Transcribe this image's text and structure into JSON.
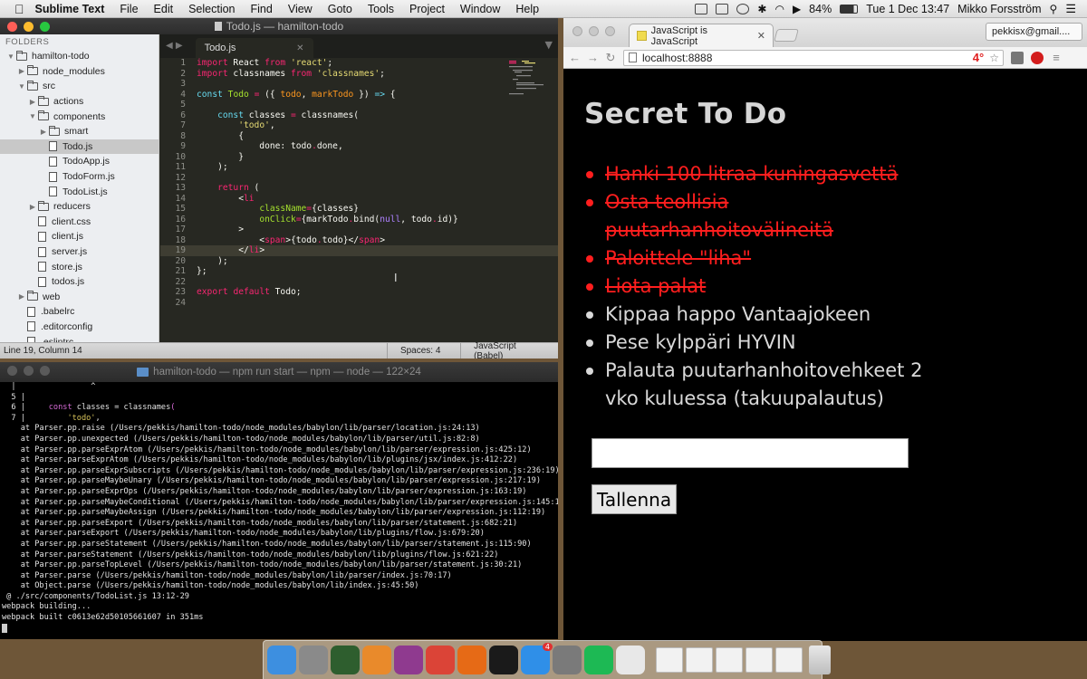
{
  "menubar": {
    "app_name": "Sublime Text",
    "items": [
      "File",
      "Edit",
      "Selection",
      "Find",
      "View",
      "Goto",
      "Tools",
      "Project",
      "Window",
      "Help"
    ],
    "battery": "84%",
    "clock": "Tue 1 Dec  13:47",
    "user": "Mikko Forsström"
  },
  "sublime": {
    "window_title": "Todo.js — hamilton-todo",
    "sidebar_header": "FOLDERS",
    "tree": [
      {
        "label": "hamilton-todo",
        "type": "folder",
        "open": true,
        "depth": 0
      },
      {
        "label": "node_modules",
        "type": "folder",
        "open": false,
        "depth": 1
      },
      {
        "label": "src",
        "type": "folder",
        "open": true,
        "depth": 1
      },
      {
        "label": "actions",
        "type": "folder",
        "open": false,
        "depth": 2
      },
      {
        "label": "components",
        "type": "folder",
        "open": true,
        "depth": 2
      },
      {
        "label": "smart",
        "type": "folder",
        "open": false,
        "depth": 3
      },
      {
        "label": "Todo.js",
        "type": "file",
        "depth": 3,
        "selected": true
      },
      {
        "label": "TodoApp.js",
        "type": "file",
        "depth": 3
      },
      {
        "label": "TodoForm.js",
        "type": "file",
        "depth": 3
      },
      {
        "label": "TodoList.js",
        "type": "file",
        "depth": 3
      },
      {
        "label": "reducers",
        "type": "folder",
        "open": false,
        "depth": 2
      },
      {
        "label": "client.css",
        "type": "file",
        "depth": 2
      },
      {
        "label": "client.js",
        "type": "file",
        "depth": 2
      },
      {
        "label": "server.js",
        "type": "file",
        "depth": 2
      },
      {
        "label": "store.js",
        "type": "file",
        "depth": 2
      },
      {
        "label": "todos.js",
        "type": "file",
        "depth": 2
      },
      {
        "label": "web",
        "type": "folder",
        "open": false,
        "depth": 1
      },
      {
        "label": ".babelrc",
        "type": "file",
        "depth": 1
      },
      {
        "label": ".editorconfig",
        "type": "file",
        "depth": 1
      },
      {
        "label": ".eslintrc",
        "type": "file",
        "depth": 1
      }
    ],
    "tab_label": "Todo.js",
    "current_line": 19,
    "code": [
      [
        [
          "kw",
          "import"
        ],
        [
          "pl",
          " React "
        ],
        [
          "kw",
          "from"
        ],
        [
          "pl",
          " "
        ],
        [
          "st",
          "'react'"
        ],
        [
          "pl",
          ";"
        ]
      ],
      [
        [
          "kw",
          "import"
        ],
        [
          "pl",
          " classnames "
        ],
        [
          "kw",
          "from"
        ],
        [
          "pl",
          " "
        ],
        [
          "st",
          "'classnames'"
        ],
        [
          "pl",
          ";"
        ]
      ],
      [],
      [
        [
          "bl",
          "const"
        ],
        [
          "pl",
          " "
        ],
        [
          "fn",
          "Todo"
        ],
        [
          "pl",
          " "
        ],
        [
          "kw",
          "="
        ],
        [
          "pl",
          " ({ "
        ],
        [
          "pr",
          "todo"
        ],
        [
          "pl",
          ", "
        ],
        [
          "pr",
          "markTodo"
        ],
        [
          "pl",
          " }) "
        ],
        [
          "bl",
          "=>"
        ],
        [
          "pl",
          " {"
        ]
      ],
      [],
      [
        [
          "pl",
          "    "
        ],
        [
          "bl",
          "const"
        ],
        [
          "pl",
          " classes "
        ],
        [
          "kw",
          "="
        ],
        [
          "pl",
          " classnames("
        ]
      ],
      [
        [
          "pl",
          "        "
        ],
        [
          "st",
          "'todo'"
        ],
        [
          "pl",
          ","
        ]
      ],
      [
        [
          "pl",
          "        {"
        ]
      ],
      [
        [
          "pl",
          "            done: todo"
        ],
        [
          "kw",
          "."
        ],
        [
          "pl",
          "done,"
        ]
      ],
      [
        [
          "pl",
          "        }"
        ]
      ],
      [
        [
          "pl",
          "    );"
        ]
      ],
      [],
      [
        [
          "pl",
          "    "
        ],
        [
          "kw",
          "return"
        ],
        [
          "pl",
          " ("
        ]
      ],
      [
        [
          "pl",
          "        <"
        ],
        [
          "kw",
          "li"
        ]
      ],
      [
        [
          "pl",
          "            "
        ],
        [
          "fn",
          "className"
        ],
        [
          "kw",
          "="
        ],
        [
          "pl",
          "{classes}"
        ]
      ],
      [
        [
          "pl",
          "            "
        ],
        [
          "fn",
          "onClick"
        ],
        [
          "kw",
          "="
        ],
        [
          "pl",
          "{markTodo"
        ],
        [
          "kw",
          "."
        ],
        [
          "pl",
          "bind("
        ],
        [
          "nm",
          "null"
        ],
        [
          "pl",
          ", todo"
        ],
        [
          "kw",
          "."
        ],
        [
          "pl",
          "id)}"
        ]
      ],
      [
        [
          "pl",
          "        >"
        ]
      ],
      [
        [
          "pl",
          "            <"
        ],
        [
          "kw",
          "span"
        ],
        [
          "pl",
          ">{todo"
        ],
        [
          "kw",
          "."
        ],
        [
          "pl",
          "todo}</"
        ],
        [
          "kw",
          "span"
        ],
        [
          "pl",
          ">"
        ]
      ],
      [
        [
          "pl",
          "        </"
        ],
        [
          "kw",
          "li"
        ],
        [
          "pl",
          ">"
        ]
      ],
      [
        [
          "pl",
          "    );"
        ]
      ],
      [
        [
          "pl",
          "};"
        ]
      ],
      [],
      [
        [
          "kw",
          "export"
        ],
        [
          "pl",
          " "
        ],
        [
          "kw",
          "default"
        ],
        [
          "pl",
          " Todo;"
        ]
      ],
      []
    ],
    "status": {
      "position": "Line 19, Column 14",
      "spaces": "Spaces: 4",
      "syntax": "JavaScript (Babel)"
    }
  },
  "terminal": {
    "title": "hamilton-todo — npm run start — npm — node — 122×24",
    "lines": [
      "  |                ^",
      "  5 |",
      "  6 |     const classes = classnames(",
      "  7 |         'todo',",
      "    at Parser.pp.raise (/Users/pekkis/hamilton-todo/node_modules/babylon/lib/parser/location.js:24:13)",
      "    at Parser.pp.unexpected (/Users/pekkis/hamilton-todo/node_modules/babylon/lib/parser/util.js:82:8)",
      "    at Parser.pp.parseExprAtom (/Users/pekkis/hamilton-todo/node_modules/babylon/lib/parser/expression.js:425:12)",
      "    at Parser.parseExprAtom (/Users/pekkis/hamilton-todo/node_modules/babylon/lib/plugins/jsx/index.js:412:22)",
      "    at Parser.pp.parseExprSubscripts (/Users/pekkis/hamilton-todo/node_modules/babylon/lib/parser/expression.js:236:19)",
      "    at Parser.pp.parseMaybeUnary (/Users/pekkis/hamilton-todo/node_modules/babylon/lib/parser/expression.js:217:19)",
      "    at Parser.pp.parseExprOps (/Users/pekkis/hamilton-todo/node_modules/babylon/lib/parser/expression.js:163:19)",
      "    at Parser.pp.parseMaybeConditional (/Users/pekkis/hamilton-todo/node_modules/babylon/lib/parser/expression.js:145:19)",
      "    at Parser.pp.parseMaybeAssign (/Users/pekkis/hamilton-todo/node_modules/babylon/lib/parser/expression.js:112:19)",
      "    at Parser.pp.parseExport (/Users/pekkis/hamilton-todo/node_modules/babylon/lib/parser/statement.js:682:21)",
      "    at Parser.parseExport (/Users/pekkis/hamilton-todo/node_modules/babylon/lib/plugins/flow.js:679:20)",
      "    at Parser.pp.parseStatement (/Users/pekkis/hamilton-todo/node_modules/babylon/lib/parser/statement.js:115:90)",
      "    at Parser.parseStatement (/Users/pekkis/hamilton-todo/node_modules/babylon/lib/plugins/flow.js:621:22)",
      "    at Parser.pp.parseTopLevel (/Users/pekkis/hamilton-todo/node_modules/babylon/lib/parser/statement.js:30:21)",
      "    at Parser.parse (/Users/pekkis/hamilton-todo/node_modules/babylon/lib/parser/index.js:70:17)",
      "    at Object.parse (/Users/pekkis/hamilton-todo/node_modules/babylon/lib/index.js:45:50)",
      " @ ./src/components/TodoList.js 13:12-29",
      "webpack building...",
      "webpack built c0613e62d50105661607 in 351ms"
    ]
  },
  "chrome": {
    "tab_title": "JavaScript is JavaScript",
    "profile": "pekkisx@gmail....",
    "url": "localhost:8888",
    "ext_badge": "4°",
    "page": {
      "heading": "Secret To Do",
      "todos": [
        {
          "text": "Hanki 100 litraa kuningasvettä",
          "done": true
        },
        {
          "text": "Osta teollisia puutarhanhoitovälineitä",
          "done": true
        },
        {
          "text": "Paloittele \"liha\"",
          "done": true
        },
        {
          "text": "Liota palat",
          "done": true
        },
        {
          "text": "Kippaa happo Vantaajokeen",
          "done": false
        },
        {
          "text": "Pese kylppäri HYVIN",
          "done": false
        },
        {
          "text": "Palauta puutarhanhoitovehkeet 2 vko kuluessa (takuupalautus)",
          "done": false
        }
      ],
      "input_value": "",
      "save_label": "Tallenna"
    }
  },
  "dock": {
    "apps": [
      {
        "name": "finder-icon",
        "color": "#3d8fe0"
      },
      {
        "name": "launchpad-icon",
        "color": "#8a8a8a"
      },
      {
        "name": "dashboard-icon",
        "color": "#2e5e2e"
      },
      {
        "name": "sublime-icon",
        "color": "#e98a2b"
      },
      {
        "name": "globe-app-icon",
        "color": "#8f3a8f"
      },
      {
        "name": "chrome-icon",
        "color": "#db4437"
      },
      {
        "name": "firefox-icon",
        "color": "#e66a16"
      },
      {
        "name": "terminal-icon",
        "color": "#1a1a1a"
      },
      {
        "name": "app-store-icon",
        "color": "#2f8fe8",
        "badge": "4"
      },
      {
        "name": "system-preferences-icon",
        "color": "#7a7a7a"
      },
      {
        "name": "spotify-icon",
        "color": "#1db954"
      },
      {
        "name": "slack-icon",
        "color": "#e8e8e8"
      }
    ],
    "docs": [
      "document-thumb-icon",
      "document-thumb-icon",
      "document-thumb-icon",
      "document-thumb-icon",
      "document-thumb-icon"
    ]
  }
}
